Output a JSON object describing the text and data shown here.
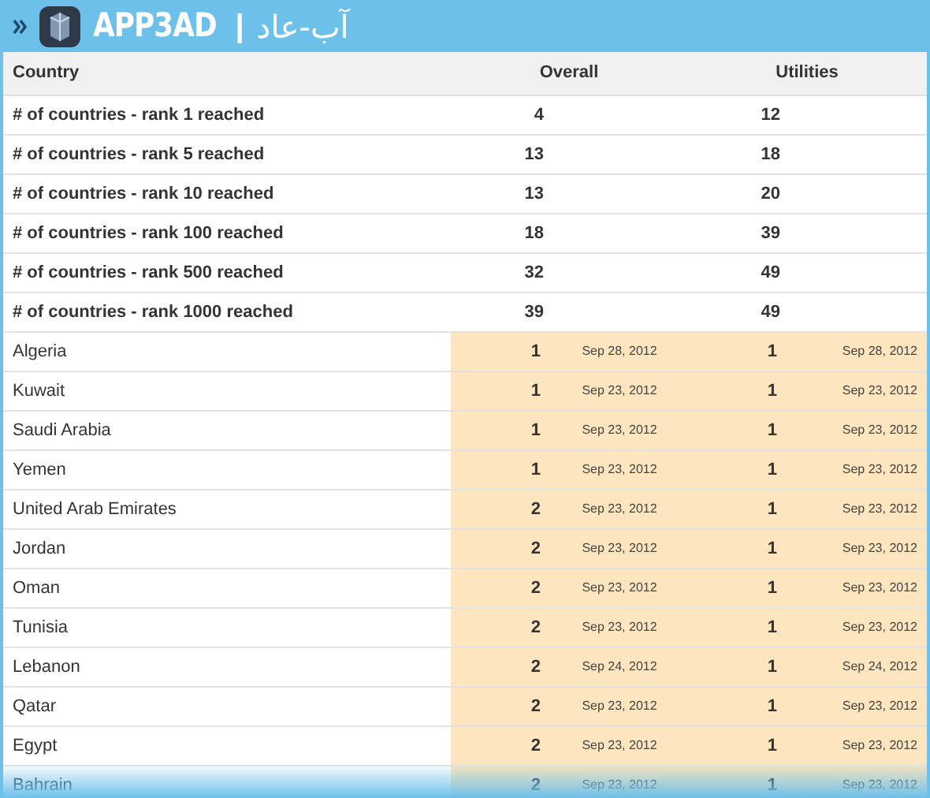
{
  "header": {
    "brand": "APP3AD",
    "separator": "|",
    "brand_arabic": "آب-عاد"
  },
  "table": {
    "columns": [
      "Country",
      "Overall",
      "Utilities"
    ],
    "summary_rows": [
      {
        "label": "# of countries - rank 1 reached",
        "overall": "4",
        "utilities": "12"
      },
      {
        "label": "# of countries - rank 5 reached",
        "overall": "13",
        "utilities": "18"
      },
      {
        "label": "# of countries - rank 10 reached",
        "overall": "13",
        "utilities": "20"
      },
      {
        "label": "# of countries - rank 100 reached",
        "overall": "18",
        "utilities": "39"
      },
      {
        "label": "# of countries - rank 500 reached",
        "overall": "32",
        "utilities": "49"
      },
      {
        "label": "# of countries - rank 1000 reached",
        "overall": "39",
        "utilities": "49"
      }
    ],
    "rows": [
      {
        "country": "Algeria",
        "overall_rank": "1",
        "overall_date": "Sep 28, 2012",
        "utilities_rank": "1",
        "utilities_date": "Sep 28, 2012"
      },
      {
        "country": "Kuwait",
        "overall_rank": "1",
        "overall_date": "Sep 23, 2012",
        "utilities_rank": "1",
        "utilities_date": "Sep 23, 2012"
      },
      {
        "country": "Saudi Arabia",
        "overall_rank": "1",
        "overall_date": "Sep 23, 2012",
        "utilities_rank": "1",
        "utilities_date": "Sep 23, 2012"
      },
      {
        "country": "Yemen",
        "overall_rank": "1",
        "overall_date": "Sep 23, 2012",
        "utilities_rank": "1",
        "utilities_date": "Sep 23, 2012"
      },
      {
        "country": "United Arab Emirates",
        "overall_rank": "2",
        "overall_date": "Sep 23, 2012",
        "utilities_rank": "1",
        "utilities_date": "Sep 23, 2012"
      },
      {
        "country": "Jordan",
        "overall_rank": "2",
        "overall_date": "Sep 23, 2012",
        "utilities_rank": "1",
        "utilities_date": "Sep 23, 2012"
      },
      {
        "country": "Oman",
        "overall_rank": "2",
        "overall_date": "Sep 23, 2012",
        "utilities_rank": "1",
        "utilities_date": "Sep 23, 2012"
      },
      {
        "country": "Tunisia",
        "overall_rank": "2",
        "overall_date": "Sep 23, 2012",
        "utilities_rank": "1",
        "utilities_date": "Sep 23, 2012"
      },
      {
        "country": "Lebanon",
        "overall_rank": "2",
        "overall_date": "Sep 24, 2012",
        "utilities_rank": "1",
        "utilities_date": "Sep 24, 2012"
      },
      {
        "country": "Qatar",
        "overall_rank": "2",
        "overall_date": "Sep 23, 2012",
        "utilities_rank": "1",
        "utilities_date": "Sep 23, 2012"
      },
      {
        "country": "Egypt",
        "overall_rank": "2",
        "overall_date": "Sep 23, 2012",
        "utilities_rank": "1",
        "utilities_date": "Sep 23, 2012"
      },
      {
        "country": "Bahrain",
        "overall_rank": "2",
        "overall_date": "Sep 23, 2012",
        "utilities_rank": "1",
        "utilities_date": "Sep 23, 2012"
      }
    ]
  }
}
